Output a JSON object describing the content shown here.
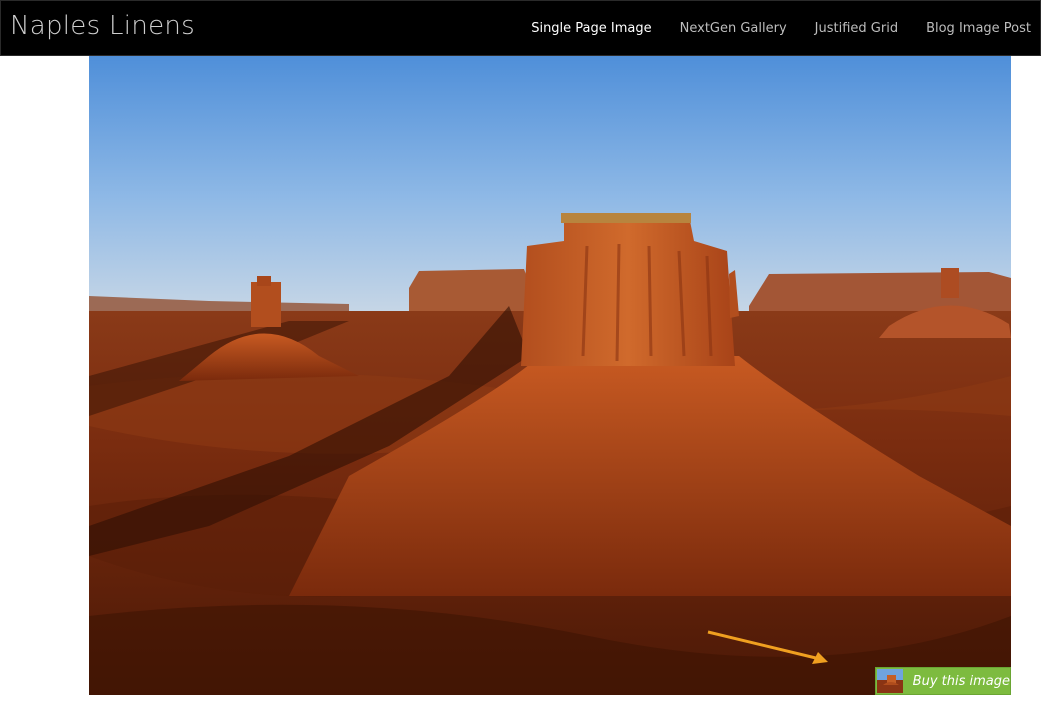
{
  "header": {
    "site_title": "Naples Linens",
    "nav": [
      {
        "label": "Single Page Image",
        "active": true
      },
      {
        "label": "NextGen Gallery",
        "active": false
      },
      {
        "label": "Justified Grid",
        "active": false
      },
      {
        "label": "Blog Image Post",
        "active": false
      }
    ]
  },
  "main": {
    "image_icon": "desert-landscape-photo",
    "annotation_icon": "orange-arrow-icon",
    "buy_button": {
      "label": "Buy this image",
      "thumbnail_icon": "desert-thumbnail-icon"
    }
  },
  "colors": {
    "header_bg": "#000000",
    "buy_button_bg": "#7dbb3f",
    "arrow": "#f0a020"
  }
}
